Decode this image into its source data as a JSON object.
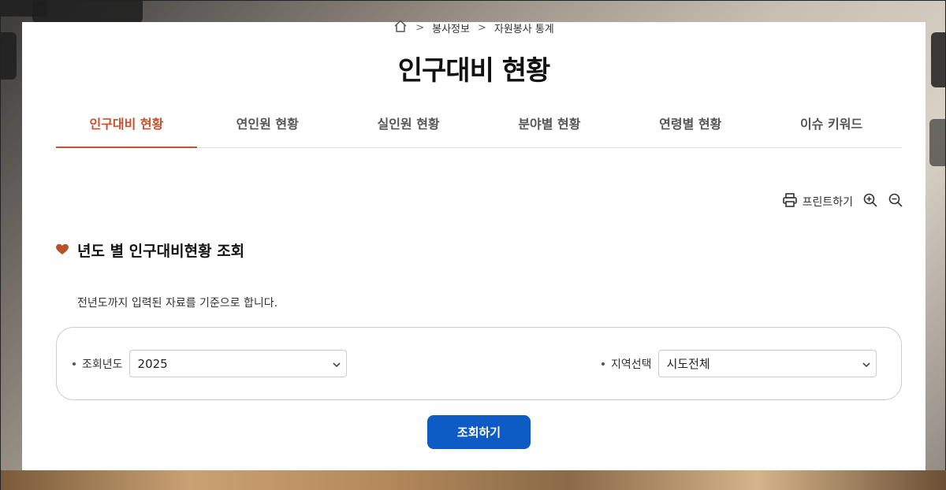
{
  "breadcrumb": {
    "items": [
      "봉사정보",
      "자원봉사 통계"
    ]
  },
  "page": {
    "title": "인구대비 현황"
  },
  "tabs": [
    {
      "label": "인구대비 현황",
      "active": true
    },
    {
      "label": "연인원 현황",
      "active": false
    },
    {
      "label": "실인원 현황",
      "active": false
    },
    {
      "label": "분야별 현황",
      "active": false
    },
    {
      "label": "연령별 현황",
      "active": false
    },
    {
      "label": "이슈 키워드",
      "active": false
    }
  ],
  "tools": {
    "print_label": "프린트하기"
  },
  "section": {
    "title": "년도 별 인구대비현황 조회",
    "description": "전년도까지 입력된 자료를 기준으로 합니다."
  },
  "search": {
    "year_label": "조회년도",
    "year_value": "2025",
    "region_label": "지역선택",
    "region_value": "시도전체",
    "submit_label": "조회하기"
  },
  "colors": {
    "accent": "#c8502a",
    "primary_button": "#0d5bc4"
  }
}
